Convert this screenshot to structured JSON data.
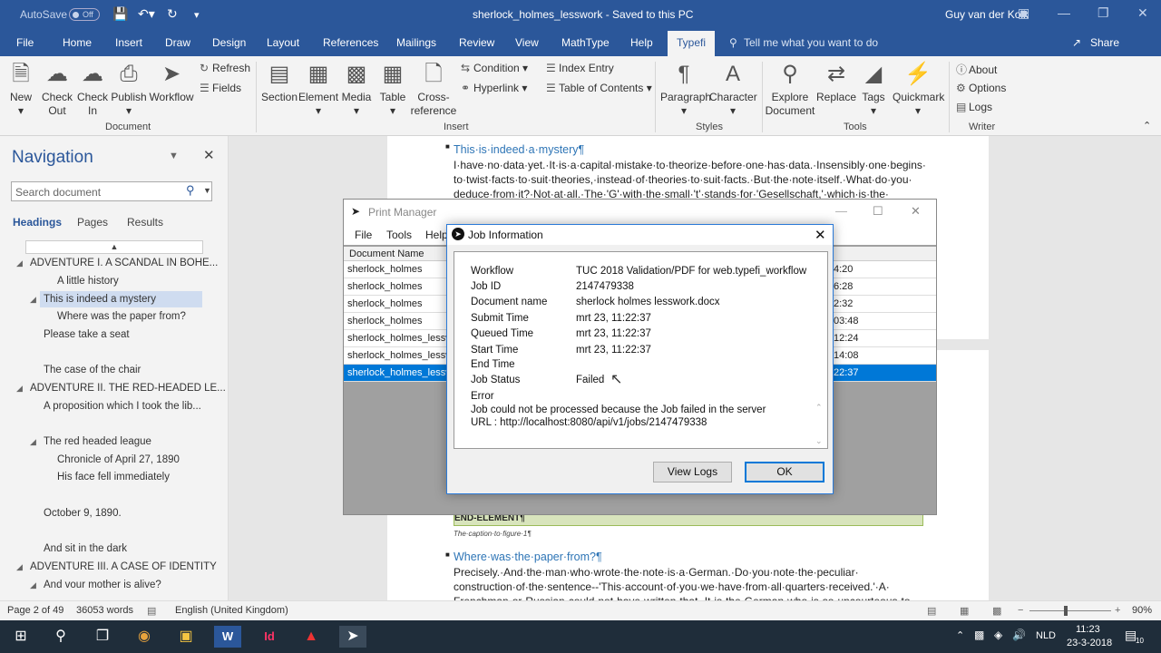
{
  "titlebar": {
    "autosave": "AutoSave",
    "autosave_state": "Off",
    "doc_title": "sherlock_holmes_lesswork  -  Saved to this PC",
    "user": "Guy van der Kolk"
  },
  "tabs": [
    "File",
    "Home",
    "Insert",
    "Draw",
    "Design",
    "Layout",
    "References",
    "Mailings",
    "Review",
    "View",
    "MathType",
    "Help",
    "Typefi"
  ],
  "tell_me": "Tell me what you want to do",
  "share": "Share",
  "ribbon": {
    "document": {
      "new": "New",
      "check_out_1": "Check",
      "check_out_2": "Out",
      "check_in_1": "Check",
      "check_in_2": "In",
      "publish": "Publish",
      "workflow": "Workflow",
      "refresh": "Refresh",
      "fields": "Fields",
      "group": "Document"
    },
    "insert": {
      "section": "Section",
      "element": "Element",
      "media": "Media",
      "table": "Table",
      "cross_1": "Cross-",
      "cross_2": "reference",
      "condition": "Condition",
      "hyperlink": "Hyperlink",
      "index_entry": "Index Entry",
      "toc": "Table of Contents",
      "group": "Insert"
    },
    "styles": {
      "paragraph": "Paragraph",
      "character": "Character",
      "group": "Styles"
    },
    "tools": {
      "explore_1": "Explore",
      "explore_2": "Document",
      "replace": "Replace",
      "tags": "Tags",
      "quickmark": "Quickmark",
      "group": "Tools"
    },
    "writer": {
      "about": "About",
      "options": "Options",
      "logs": "Logs",
      "group": "Writer"
    }
  },
  "navigation": {
    "title": "Navigation",
    "search_placeholder": "Search document",
    "tabs": [
      "Headings",
      "Pages",
      "Results"
    ],
    "items": [
      "ADVENTURE I. A SCANDAL IN BOHE...",
      "A little history",
      "This is indeed a mystery",
      "Where was the paper from?",
      "Please take a seat",
      "The case of the chair",
      "ADVENTURE II. THE RED-HEADED LE...",
      "A proposition which I took the lib...",
      "The red headed league",
      "Chronicle of April 27, 1890",
      "His face fell immediately",
      "October 9, 1890.",
      "And sit in the dark",
      "ADVENTURE III. A CASE OF IDENTITY",
      "And vour mother is alive?"
    ]
  },
  "document": {
    "heading1": "This·is·indeed·a·mystery¶",
    "para1": [
      "I·have·no·data·yet.·It·is·a·capital·mistake·to·theorize·before·one·has·data.·Insensibly·one·begins·",
      "to·twist·facts·to·suit·theories,·instead·of·theories·to·suit·facts.·But·the·note·itself.·What·do·you·",
      "deduce·from·it?·Not·at·all.·The·'G'·with·the·small·'t'·stands·for·'Gesellschaft,'·which·is·the·"
    ],
    "end_element": "END-ELEMENT¶",
    "caption": "The·caption·to·figure·1¶",
    "heading2": "Where·was·the·paper·from?¶",
    "para2": [
      "Precisely.·And·the·man·who·wrote·the·note·is·a·German.·Do·you·note·the·peculiar·",
      "construction·of·the·sentence--'This·account·of·you·we·have·from·all·quarters·received.'·A·",
      "Frenchman·or·Russian·could·not·have·written·that.·It·is·the·German·who·is·so·uncourteous·to·"
    ]
  },
  "print_manager": {
    "title": "Print Manager",
    "menu": [
      "File",
      "Tools",
      "Help"
    ],
    "column": "Document Name",
    "rows": [
      {
        "name": "sherlock_holmes",
        "time": "4:20"
      },
      {
        "name": "sherlock_holmes",
        "time": "6:28"
      },
      {
        "name": "sherlock_holmes",
        "time": "2:32"
      },
      {
        "name": "sherlock_holmes",
        "time": "03:48"
      },
      {
        "name": "sherlock_holmes_lesswo",
        "time": "12:24"
      },
      {
        "name": "sherlock_holmes_lesswo",
        "time": "14:08"
      },
      {
        "name": "sherlock_holmes_lesswo",
        "time": "22:37"
      }
    ]
  },
  "job_info": {
    "title": "Job Information",
    "fields": [
      {
        "key": "Workflow",
        "value": "TUC 2018 Validation/PDF for web.typefi_workflow"
      },
      {
        "key": "Job ID",
        "value": "2147479338"
      },
      {
        "key": "Document name",
        "value": "sherlock  holmes  lesswork.docx"
      },
      {
        "key": "Submit Time",
        "value": "mrt 23, 11:22:37"
      },
      {
        "key": "Queued Time",
        "value": "mrt 23, 11:22:37"
      },
      {
        "key": "Start Time",
        "value": "mrt 23, 11:22:37"
      },
      {
        "key": "End Time",
        "value": ""
      },
      {
        "key": "Job Status",
        "value": "Failed"
      }
    ],
    "error_label": "Error",
    "error_line1": "Job could not be processed because the Job failed in the server",
    "error_line2": "URL : http://localhost:8080/api/v1/jobs/2147479338",
    "view_logs": "View Logs",
    "ok": "OK"
  },
  "status": {
    "page": "Page 2 of 49",
    "words": "36053 words",
    "language": "English (United Kingdom)",
    "zoom": "90%"
  },
  "taskbar": {
    "lang": "NLD",
    "time": "11:23",
    "date": "23-3-2018",
    "notifications": "10"
  }
}
